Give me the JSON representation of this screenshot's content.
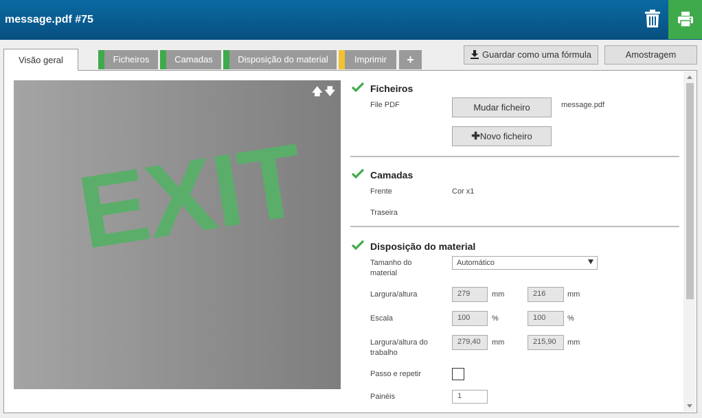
{
  "header": {
    "title": "message.pdf #75",
    "icons": {
      "trash": "trash-icon",
      "print": "printer-icon"
    },
    "colors": {
      "bar": "#0b6aa2",
      "print_button": "#3faa4b"
    }
  },
  "tabs": [
    {
      "label": "Visão geral",
      "active": true,
      "status": ""
    },
    {
      "label": "Ficheiros",
      "status": "#3faa4b"
    },
    {
      "label": "Camadas",
      "status": "#3faa4b"
    },
    {
      "label": "Disposição do material",
      "status": "#3faa4b"
    },
    {
      "label": "Imprimir",
      "status": "#f1c232"
    },
    {
      "label": "+",
      "status": ""
    }
  ],
  "toolbar": {
    "save_formula": "Guardar como uma fórmula",
    "sampling": "Amostragem"
  },
  "preview": {
    "text": "EXIT",
    "arrow_up": "🡅",
    "arrow_down": "🡇"
  },
  "ficheiros": {
    "title": "Ficheiros",
    "pdf_label": "File PDF",
    "change_button": "Mudar ficheiro",
    "filename": "message.pdf",
    "new_button": "Novo ficheiro"
  },
  "camadas": {
    "title": "Camadas",
    "front_label": "Frente",
    "front_value": "Cor x1",
    "back_label": "Traseira"
  },
  "disposicao": {
    "title": "Disposição do material",
    "size_label": "Tamanho do material",
    "size_value": "Automático",
    "wh_label": "Largura/altura",
    "width": "279",
    "height": "216",
    "unit_mm": "mm",
    "scale_label": "Escala",
    "scale_x": "100",
    "scale_y": "100",
    "unit_pct": "%",
    "job_wh_label": "Largura/altura do trabalho",
    "job_width": "279,40",
    "job_height": "215,90",
    "step_repeat_label": "Passo e repetir",
    "panels_label": "Painéis",
    "panels_value": "1"
  }
}
